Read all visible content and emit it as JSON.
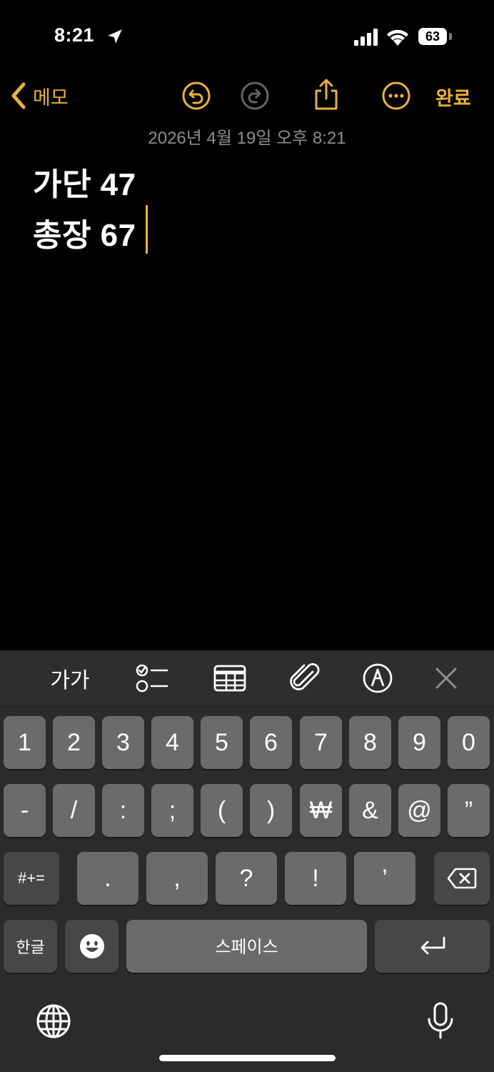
{
  "status_bar": {
    "time": "8:21",
    "battery": "63",
    "icons": [
      "location-arrow-icon",
      "cellular-signal-icon",
      "wifi-icon",
      "battery-icon"
    ]
  },
  "nav": {
    "back_label": "메모",
    "done_label": "완료",
    "icons": [
      "back-chevron-icon",
      "undo-icon",
      "redo-icon",
      "share-icon",
      "more-icon"
    ]
  },
  "note": {
    "date": "2026년 4월 19일 오후 8:21",
    "lines": [
      "가단 47",
      "총장 67"
    ]
  },
  "keyboard_toolbar": {
    "format_label": "가가",
    "icons": [
      "checklist-icon",
      "table-icon",
      "paperclip-icon",
      "markup-pen-icon",
      "close-icon"
    ]
  },
  "keyboard": {
    "row1": [
      "1",
      "2",
      "3",
      "4",
      "5",
      "6",
      "7",
      "8",
      "9",
      "0"
    ],
    "row2": [
      "-",
      "/",
      ":",
      ";",
      "(",
      ")",
      "₩",
      "&",
      "@",
      "”"
    ],
    "row3_left": "#+=",
    "row3": [
      ".",
      ",",
      "?",
      "!",
      "’"
    ],
    "lang_key": "한글",
    "space_label": "스페이스",
    "bottom_icons": [
      "globe-icon",
      "microphone-icon",
      "emoji-icon",
      "backspace-icon",
      "return-icon"
    ]
  },
  "colors": {
    "accent": "#e9b23a",
    "background": "#000000",
    "key": "#6b6b6b",
    "key_dark": "#474747"
  }
}
